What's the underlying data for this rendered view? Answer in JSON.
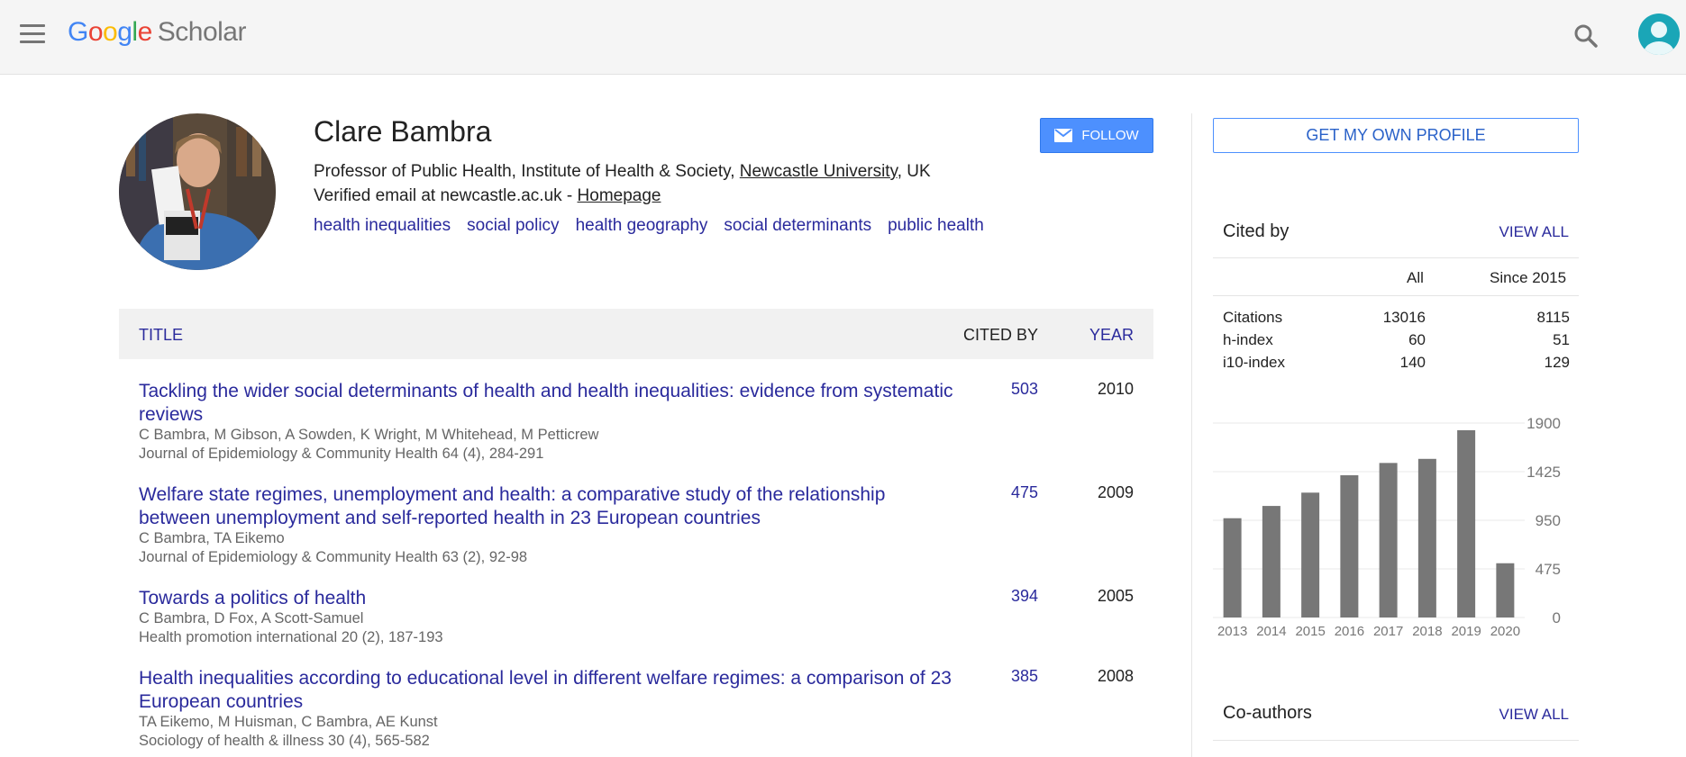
{
  "header": {
    "logo_google": "Google",
    "logo_scholar": "Scholar"
  },
  "profile": {
    "name": "Clare Bambra",
    "affiliation_prefix": "Professor of Public Health, Institute of Health & Society, ",
    "affiliation_link": "Newcastle University",
    "affiliation_suffix": ", UK",
    "email_prefix": "Verified email at newcastle.ac.uk - ",
    "homepage_label": "Homepage",
    "interests": [
      "health inequalities",
      "social policy",
      "health geography",
      "social determinants",
      "public health"
    ],
    "follow_label": "FOLLOW"
  },
  "table": {
    "col_title": "TITLE",
    "col_cited": "CITED BY",
    "col_year": "YEAR",
    "rows": [
      {
        "title": "Tackling the wider social determinants of health and health inequalities: evidence from systematic reviews",
        "authors": "C Bambra, M Gibson, A Sowden, K Wright, M Whitehead, M Petticrew",
        "journal": "Journal of Epidemiology & Community Health 64 (4), 284-291",
        "cited": "503",
        "year": "2010"
      },
      {
        "title": "Welfare state regimes, unemployment and health: a comparative study of the relationship between unemployment and self-reported health in 23 European countries",
        "authors": "C Bambra, TA Eikemo",
        "journal": "Journal of Epidemiology & Community Health 63 (2), 92-98",
        "cited": "475",
        "year": "2009"
      },
      {
        "title": "Towards a politics of health",
        "authors": "C Bambra, D Fox, A Scott-Samuel",
        "journal": "Health promotion international 20 (2), 187-193",
        "cited": "394",
        "year": "2005"
      },
      {
        "title": "Health inequalities according to educational level in different welfare regimes: a comparison of 23 European countries",
        "authors": "TA Eikemo, M Huisman, C Bambra, AE Kunst",
        "journal": "Sociology of health & illness 30 (4), 565-582",
        "cited": "385",
        "year": "2008"
      }
    ]
  },
  "sidebar": {
    "own_profile_label": "GET MY OWN PROFILE",
    "cited_by_title": "Cited by",
    "view_all": "VIEW ALL",
    "col_all": "All",
    "col_since": "Since 2015",
    "stats": [
      {
        "label": "Citations",
        "all": "13016",
        "since": "8115"
      },
      {
        "label": "h-index",
        "all": "60",
        "since": "51"
      },
      {
        "label": "i10-index",
        "all": "140",
        "since": "129"
      }
    ],
    "coauthors_title": "Co-authors",
    "coauthors_view_all": "VIEW ALL"
  },
  "chart_data": {
    "type": "bar",
    "categories": [
      "2013",
      "2014",
      "2015",
      "2016",
      "2017",
      "2018",
      "2019",
      "2020"
    ],
    "values": [
      970,
      1090,
      1220,
      1390,
      1510,
      1550,
      1830,
      530
    ],
    "yticks": [
      "1900",
      "1425",
      "950",
      "475",
      "0"
    ],
    "ylim": [
      0,
      1900
    ],
    "bar_color": "#777777",
    "grid": true
  },
  "icons": {
    "menu": "menu-icon",
    "search": "search-icon",
    "account": "account-icon",
    "mail": "mail-icon"
  }
}
